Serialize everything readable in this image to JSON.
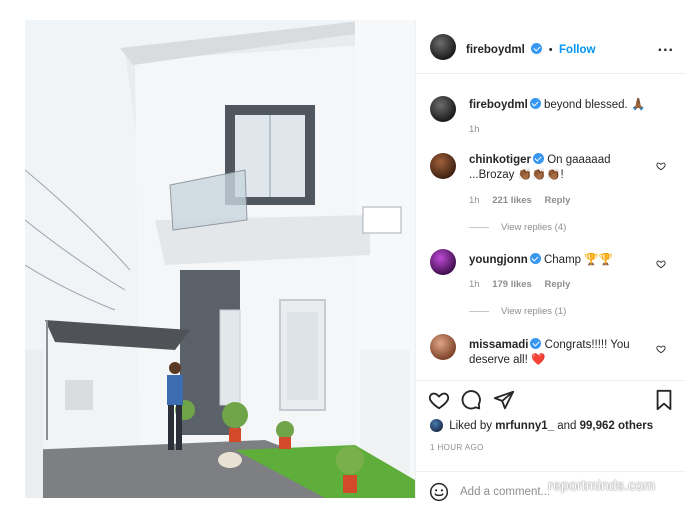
{
  "post": {
    "author": "fireboydml",
    "follow_label": "Follow",
    "dot": "•",
    "more_label": "..."
  },
  "caption": {
    "author": "fireboydml",
    "text": "beyond blessed. 🙏🏾",
    "time": "1h"
  },
  "comments": [
    {
      "author": "chinkotiger",
      "text": "On gaaaaad ...Brozay 👏🏾👏🏾👏🏾!",
      "time": "1h",
      "likes": "221 likes",
      "reply": "Reply",
      "view_replies": "View replies (4)",
      "avatar_color": "#6b3a1e"
    },
    {
      "author": "youngjonn",
      "text": "Champ 🏆🏆",
      "time": "1h",
      "likes": "179 likes",
      "reply": "Reply",
      "view_replies": "View replies (1)",
      "avatar_color": "#7b2a9a"
    },
    {
      "author": "missamadi",
      "text": "Congrats!!!!! You deserve all! ❤️",
      "avatar_color": "#c98a6a"
    }
  ],
  "likes": {
    "prefix": "Liked by",
    "user": "mrfunny1_",
    "middle": "and",
    "count": "99,962 others"
  },
  "timestamp": "1 HOUR AGO",
  "add_comment": {
    "placeholder": "Add a comment..."
  },
  "watermark": "reportminds.com",
  "icons": [
    "heart-icon",
    "comment-icon",
    "share-icon",
    "bookmark-icon",
    "emoji-icon",
    "more-icon"
  ],
  "colors": {
    "accent": "#0095f6",
    "verified": "#3897f0",
    "text": "#262626",
    "muted": "#8e8e8e"
  }
}
